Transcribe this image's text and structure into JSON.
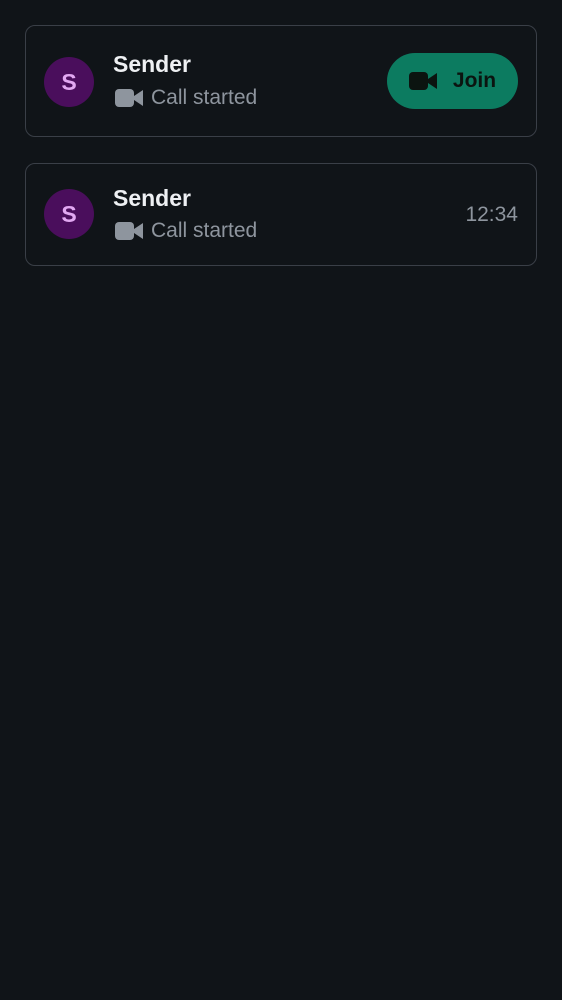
{
  "calls": [
    {
      "avatar_initial": "S",
      "sender": "Sender",
      "status_icon": "video-camera-icon",
      "status_text": "Call started",
      "action": {
        "label": "Join",
        "icon": "video-camera-icon"
      }
    },
    {
      "avatar_initial": "S",
      "sender": "Sender",
      "status_icon": "video-camera-icon",
      "status_text": "Call started",
      "time": "12:34"
    }
  ],
  "colors": {
    "background": "#101418",
    "card_border": "#3a3f47",
    "avatar_bg": "#4a0e5c",
    "avatar_text": "#e2a8f2",
    "join_bg": "#0c7b60",
    "muted_text": "#8e959e",
    "primary_text": "#eef0f3"
  }
}
